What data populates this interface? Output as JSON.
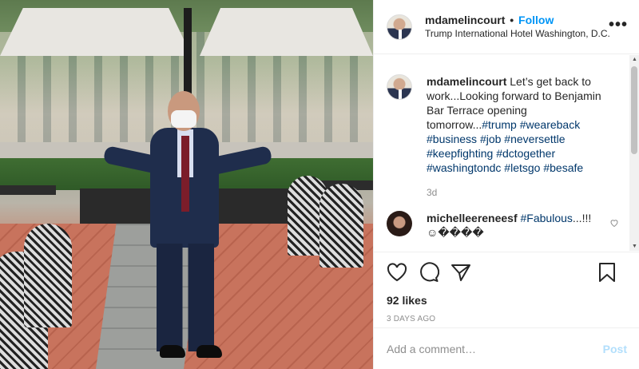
{
  "header": {
    "username": "mdamelincourt",
    "separator": "•",
    "follow_label": "Follow",
    "location": "Trump International Hotel Washington, D.C.",
    "more_icon": "ellipsis-icon",
    "more_glyph": "•••"
  },
  "caption": {
    "username": "mdamelincourt",
    "text": "Let’s get back to work...Looking forward to Benjamin Bar Terrace opening tomorrow...",
    "hashtags": [
      "#trump",
      "#weareback",
      "#business",
      "#job",
      "#neversettle",
      "#keepfighting",
      "#dctogether",
      "#washingtondc",
      "#letsgo",
      "#besafe"
    ],
    "time": "3d"
  },
  "comment": {
    "username": "michelleereneesf",
    "tag": "#Fabulous",
    "text": "...!!!",
    "emoji_line": "☺����"
  },
  "actions": {
    "icons": [
      "heart-icon",
      "comment-icon",
      "share-icon",
      "bookmark-icon"
    ],
    "likes": "92 likes",
    "date": "3 DAYS AGO"
  },
  "add_comment": {
    "placeholder": "Add a comment…",
    "post_label": "Post"
  },
  "colors": {
    "link": "#0095f6",
    "hashtag": "#00376b",
    "muted": "#8e8e8e",
    "post_disabled": "#b2dffc"
  }
}
